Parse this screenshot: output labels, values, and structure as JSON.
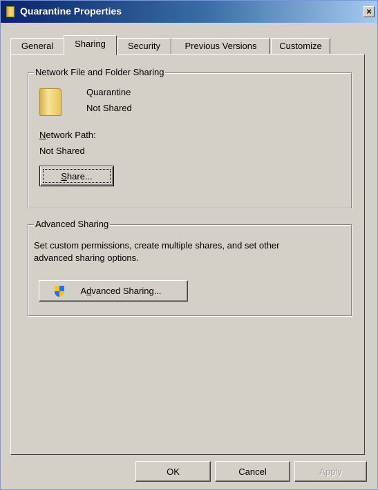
{
  "window": {
    "title": "Quarantine Properties",
    "close_label": "×"
  },
  "tabs": [
    {
      "label": "General",
      "active": false
    },
    {
      "label": "Sharing",
      "active": true
    },
    {
      "label": "Security",
      "active": false
    },
    {
      "label": "Previous Versions",
      "active": false
    },
    {
      "label": "Customize",
      "active": false
    }
  ],
  "network_sharing": {
    "group_title": "Network File and Folder Sharing",
    "folder_name": "Quarantine",
    "share_status": "Not Shared",
    "network_path_label": "Network Path:",
    "network_path_accel": "N",
    "network_path_rest": "etwork Path:",
    "network_path_value": "Not Shared",
    "share_button_accel": "S",
    "share_button_rest": "hare..."
  },
  "advanced_sharing": {
    "group_title": "Advanced Sharing",
    "description_line1": "Set custom permissions, create multiple shares, and set other",
    "description_line2": "advanced sharing options.",
    "button_pre": "A",
    "button_accel": "d",
    "button_rest": "vanced Sharing..."
  },
  "footer": {
    "ok_label": "OK",
    "cancel_label": "Cancel",
    "apply_label": "Apply"
  }
}
